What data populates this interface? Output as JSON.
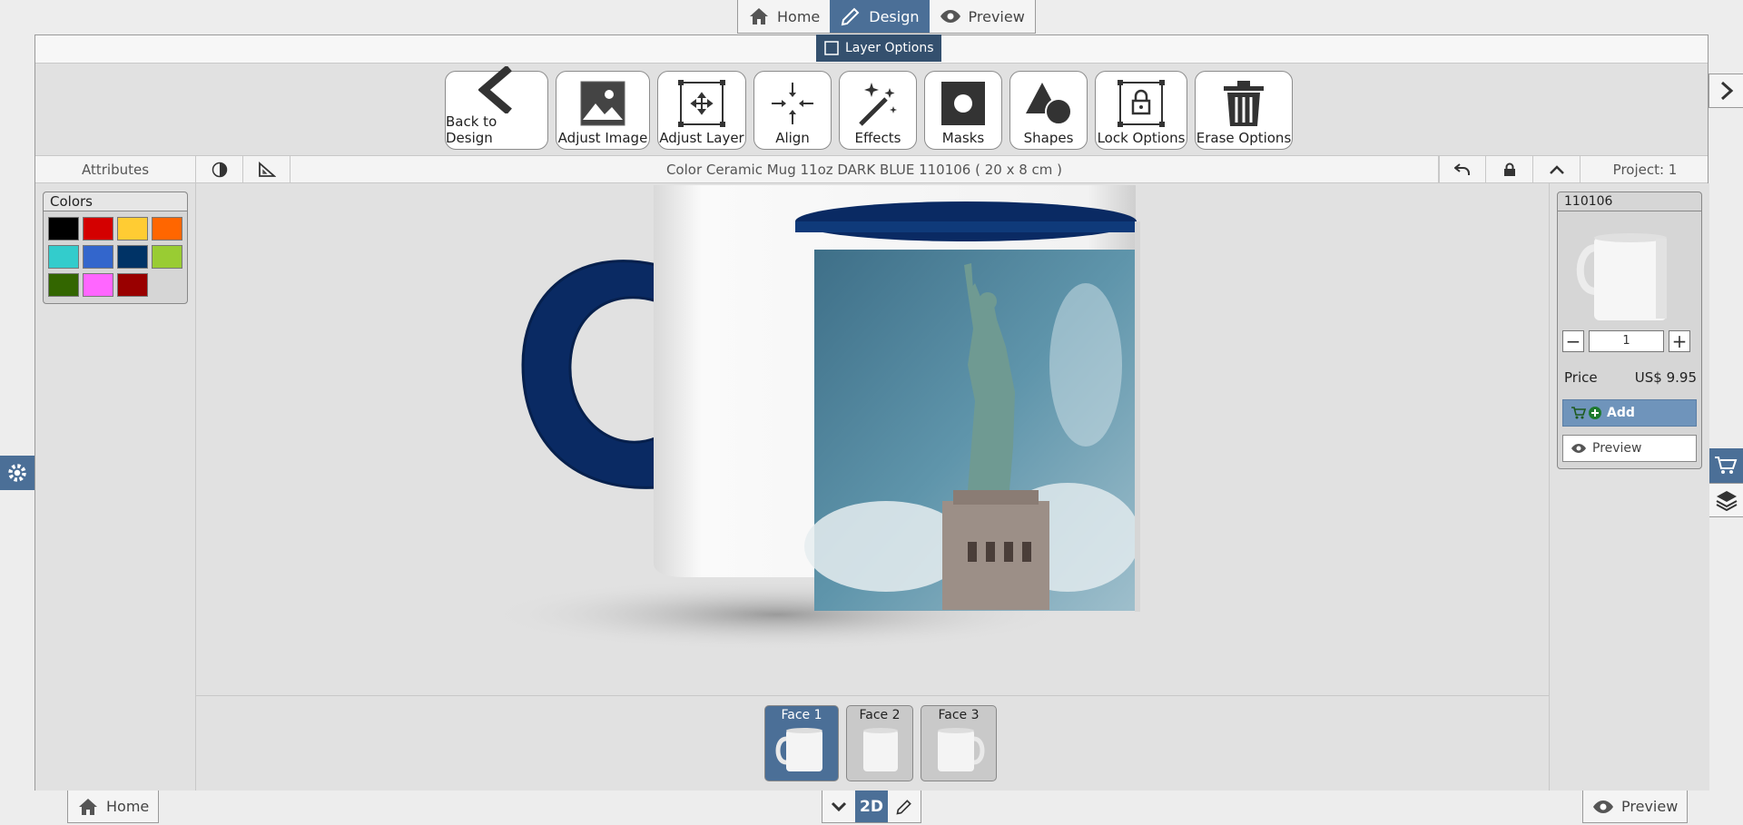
{
  "top_nav": {
    "tabs": [
      {
        "label": "Home",
        "icon": "home-icon"
      },
      {
        "label": "Design",
        "icon": "pencil-icon",
        "active": true
      },
      {
        "label": "Preview",
        "icon": "eye-icon"
      }
    ]
  },
  "layer_options": {
    "label": "Layer Options"
  },
  "toolbar": {
    "tools": [
      {
        "label": "Back to Design",
        "icon": "chevron-left-icon"
      },
      {
        "label": "Adjust Image",
        "icon": "image-icon"
      },
      {
        "label": "Adjust Layer",
        "icon": "move-layer-icon"
      },
      {
        "label": "Align",
        "icon": "align-icon"
      },
      {
        "label": "Effects",
        "icon": "magic-wand-icon"
      },
      {
        "label": "Masks",
        "icon": "mask-icon"
      },
      {
        "label": "Shapes",
        "icon": "shapes-icon"
      },
      {
        "label": "Lock Options",
        "icon": "lock-icon"
      },
      {
        "label": "Erase Options",
        "icon": "trash-icon"
      }
    ]
  },
  "info_bar": {
    "attributes_label": "Attributes",
    "product_title": "Color Ceramic Mug 11oz DARK BLUE 110106 ( 20 x 8 cm )",
    "project_label": "Project: 1"
  },
  "colors_panel": {
    "title": "Colors",
    "swatches": [
      "#000000",
      "#d40000",
      "#ffcc33",
      "#ff6600",
      "#33cccc",
      "#3366cc",
      "#003366",
      "#99cc33",
      "#336600",
      "#ff66ff",
      "#990000"
    ]
  },
  "product_panel": {
    "code": "110106",
    "quantity": "1",
    "price_label": "Price",
    "price_value": "US$ 9.95",
    "add_label": "Add",
    "preview_label": "Preview"
  },
  "faces": [
    {
      "label": "Face 1",
      "active": true
    },
    {
      "label": "Face 2",
      "active": false
    },
    {
      "label": "Face 3",
      "active": false
    }
  ],
  "bottom_bar": {
    "home_label": "Home",
    "mode_label": "2D",
    "preview_label": "Preview"
  },
  "colors": {
    "accent": "#4b6f97",
    "dark_accent": "#34506e",
    "mug_blue": "#0a2a63"
  }
}
